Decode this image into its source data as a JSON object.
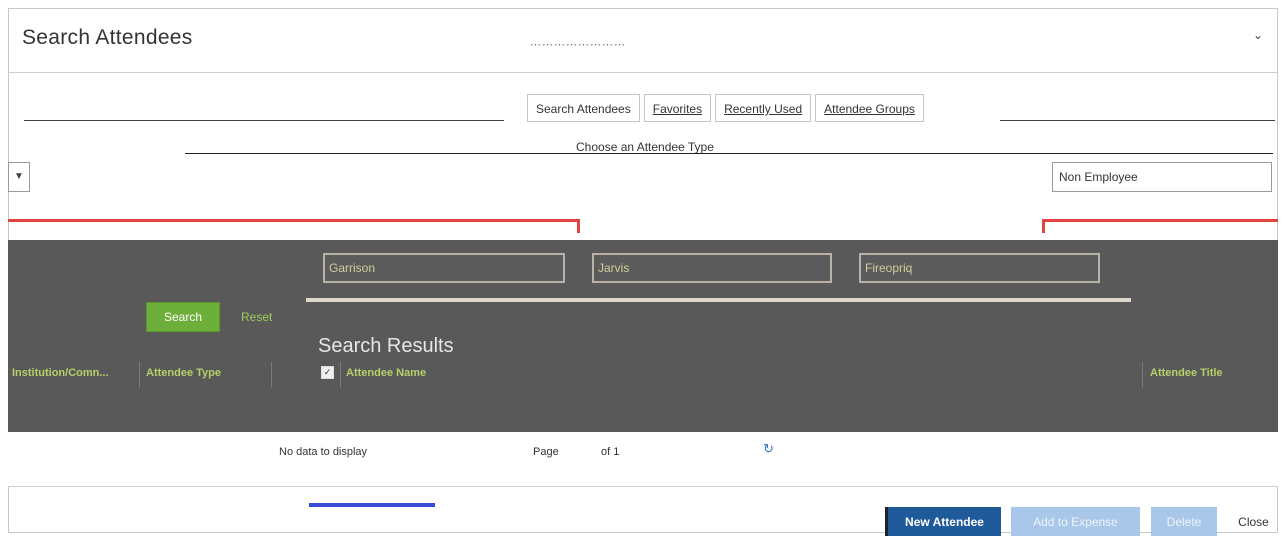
{
  "dialog": {
    "title": "Search Attendees",
    "collapse_icon": "chevron-down-icon"
  },
  "tabs": [
    {
      "label": "Search Attendees"
    },
    {
      "label": "Favorites"
    },
    {
      "label": "Recently Used"
    },
    {
      "label": "Attendee Groups"
    }
  ],
  "type_section": {
    "label": "Choose an Attendee Type",
    "selected_type": "Non Employee"
  },
  "search_form": {
    "fields": [
      {
        "value": "Garrison"
      },
      {
        "value": "Jarvis"
      },
      {
        "value": "Fireopriq"
      }
    ],
    "search_label": "Search",
    "reset_label": "Reset"
  },
  "results": {
    "title": "Search Results",
    "columns": {
      "left": [
        "Institution/Comn...",
        "Attendee Type"
      ],
      "attendee_name": "Attendee Name",
      "attendee_title": "Attendee Title"
    },
    "empty_text": "No data to display",
    "page_label": "Page",
    "page_of": "of 1"
  },
  "footer": {
    "new_attendee": "New Attendee",
    "add_to_expense": "Add to Expense",
    "delete": "Delete",
    "close": "Close"
  },
  "colors": {
    "primary": "#1f5a9b",
    "disabled": "#a9c7e8",
    "search_button": "#6eae3a",
    "accent_red": "#e0443f",
    "panel": "#595959"
  }
}
